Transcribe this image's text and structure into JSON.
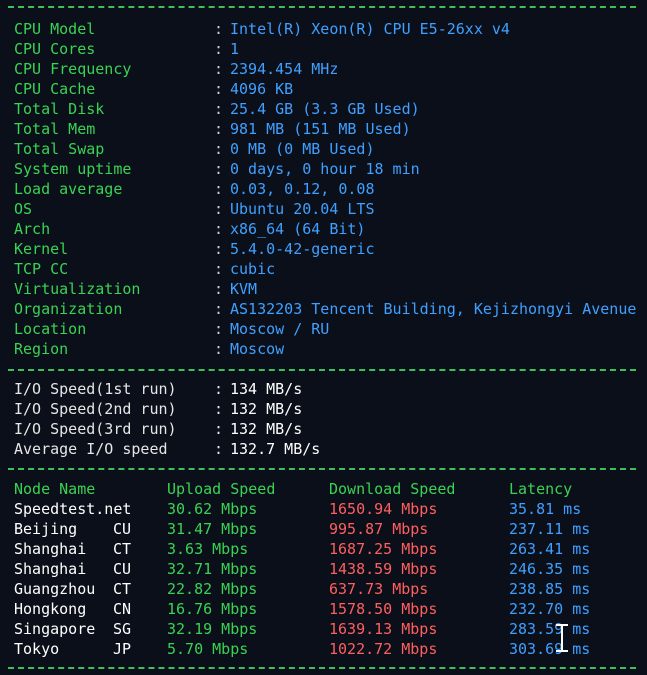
{
  "system_info": [
    {
      "label": "CPU Model",
      "value": "Intel(R) Xeon(R) CPU E5-26xx v4"
    },
    {
      "label": "CPU Cores",
      "value": "1"
    },
    {
      "label": "CPU Frequency",
      "value": "2394.454 MHz"
    },
    {
      "label": "CPU Cache",
      "value": "4096 KB"
    },
    {
      "label": "Total Disk",
      "value": "25.4 GB (3.3 GB Used)"
    },
    {
      "label": "Total Mem",
      "value": "981 MB (151 MB Used)"
    },
    {
      "label": "Total Swap",
      "value": "0 MB (0 MB Used)"
    },
    {
      "label": "System uptime",
      "value": "0 days, 0 hour 18 min"
    },
    {
      "label": "Load average",
      "value": "0.03, 0.12, 0.08"
    },
    {
      "label": "OS",
      "value": "Ubuntu 20.04 LTS"
    },
    {
      "label": "Arch",
      "value": "x86_64 (64 Bit)"
    },
    {
      "label": "Kernel",
      "value": "5.4.0-42-generic"
    },
    {
      "label": "TCP CC",
      "value": "cubic"
    },
    {
      "label": "Virtualization",
      "value": "KVM"
    },
    {
      "label": "Organization",
      "value": "AS132203 Tencent Building, Kejizhongyi Avenue"
    },
    {
      "label": "Location",
      "value": "Moscow / RU"
    },
    {
      "label": "Region",
      "value": "Moscow"
    }
  ],
  "io_speed": [
    {
      "label": "I/O Speed(1st run)",
      "value": "134 MB/s"
    },
    {
      "label": "I/O Speed(2nd run)",
      "value": "132 MB/s"
    },
    {
      "label": "I/O Speed(3rd run)",
      "value": "132 MB/s"
    },
    {
      "label": "Average I/O speed",
      "value": "132.7 MB/s"
    }
  ],
  "speedtest": {
    "headers": {
      "node": "Node Name",
      "upload": "Upload Speed",
      "download": "Download Speed",
      "latency": "Latency"
    },
    "rows": [
      {
        "node": "Speedtest.net",
        "cc": "",
        "upload": "30.62 Mbps",
        "download": "1650.94 Mbps",
        "latency": "35.81 ms"
      },
      {
        "node": "Beijing",
        "cc": "CU",
        "upload": "31.47 Mbps",
        "download": "995.87 Mbps",
        "latency": "237.11 ms"
      },
      {
        "node": "Shanghai",
        "cc": "CT",
        "upload": "3.63 Mbps",
        "download": "1687.25 Mbps",
        "latency": "263.41 ms"
      },
      {
        "node": "Shanghai",
        "cc": "CU",
        "upload": "32.71 Mbps",
        "download": "1438.59 Mbps",
        "latency": "246.35 ms"
      },
      {
        "node": "Guangzhou",
        "cc": "CT",
        "upload": "22.82 Mbps",
        "download": "637.73 Mbps",
        "latency": "238.85 ms"
      },
      {
        "node": "Hongkong",
        "cc": "CN",
        "upload": "16.76 Mbps",
        "download": "1578.50 Mbps",
        "latency": "232.70 ms"
      },
      {
        "node": "Singapore",
        "cc": "SG",
        "upload": "32.19 Mbps",
        "download": "1639.13 Mbps",
        "latency": "283.59 ms"
      },
      {
        "node": "Tokyo",
        "cc": "JP",
        "upload": "5.70 Mbps",
        "download": "1022.72 Mbps",
        "latency": "303.69 ms"
      }
    ]
  },
  "separator": ":",
  "colors": {
    "background": "#0b0f1a",
    "label_green": "#39d353",
    "value_blue": "#3fa0ff",
    "download_red": "#ff5f5f",
    "io_white": "#ffffff"
  },
  "icons": {
    "cursor": "text-cursor-icon"
  }
}
